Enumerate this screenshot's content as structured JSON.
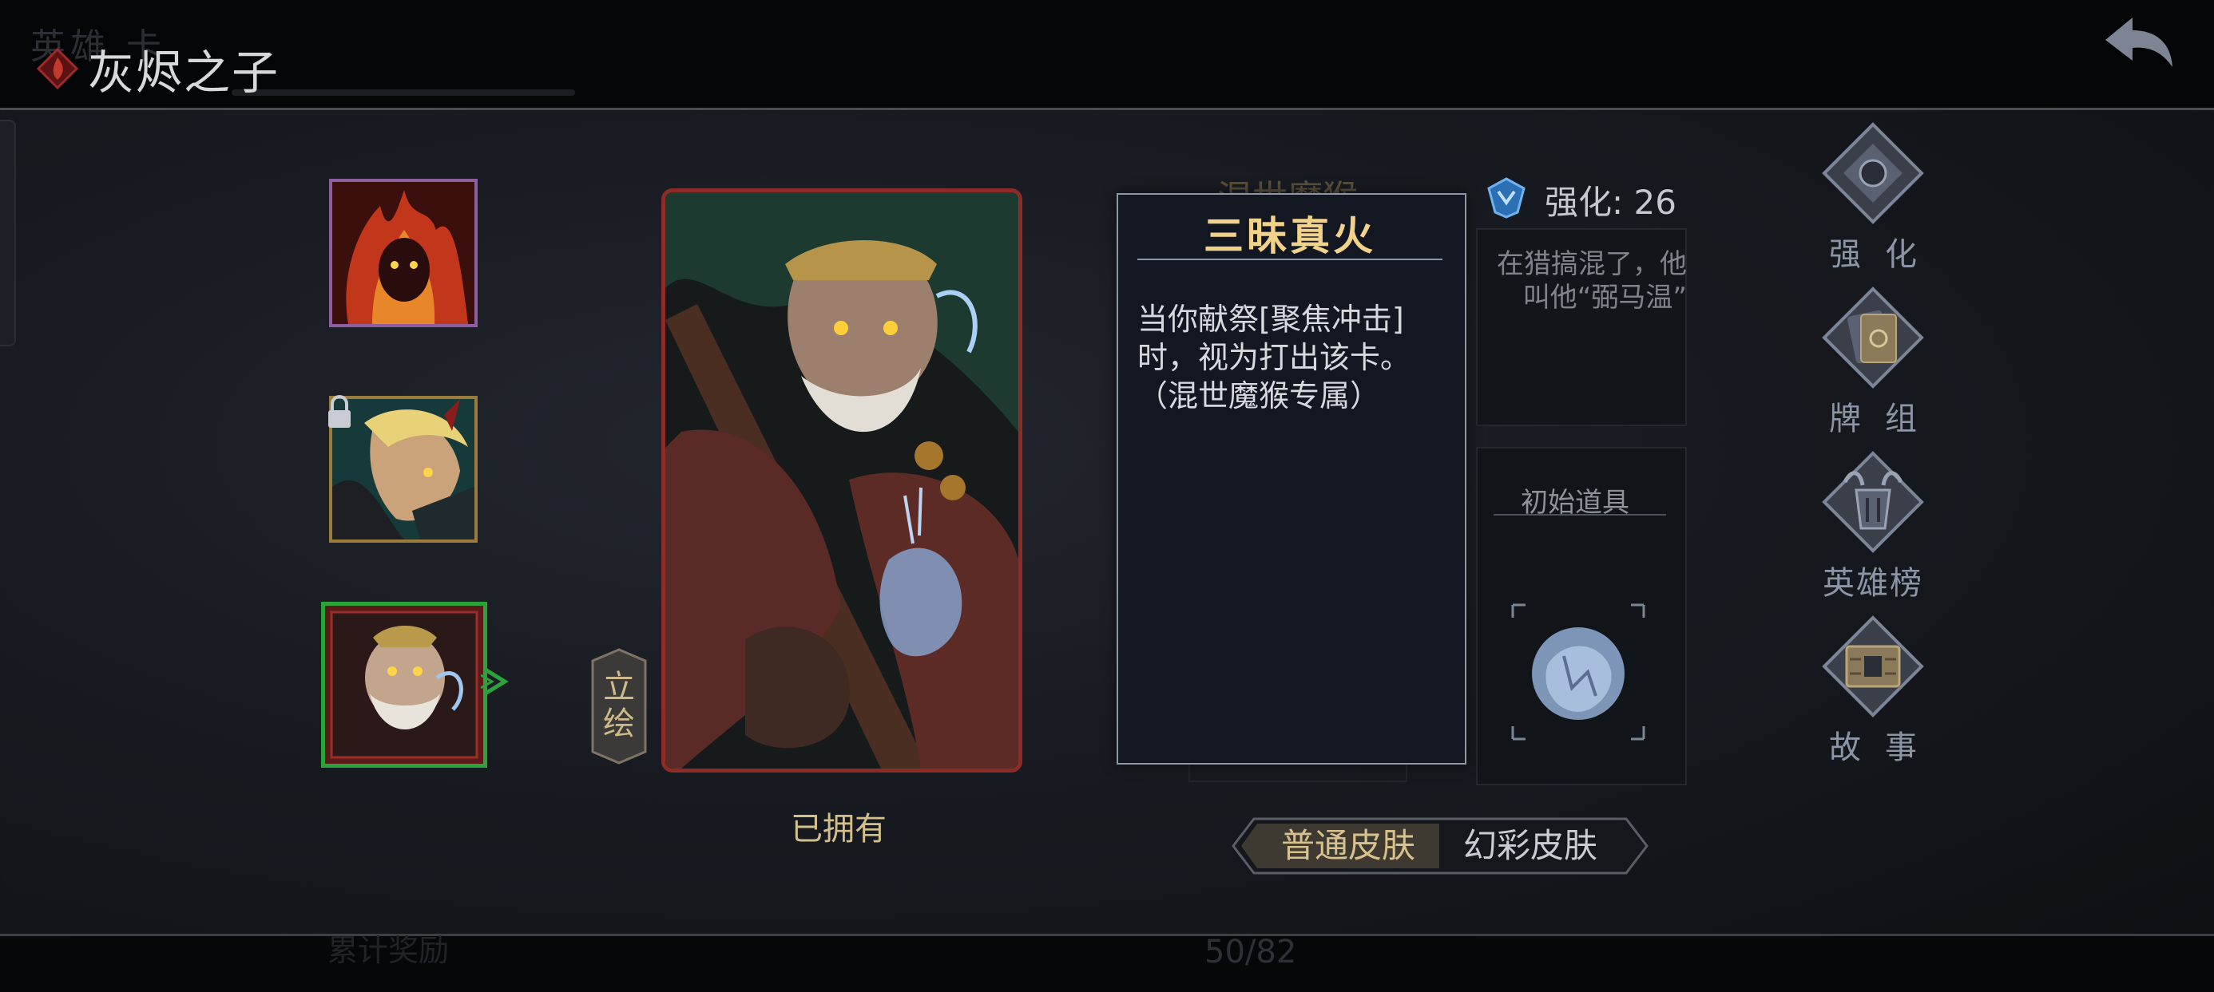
{
  "header": {
    "title": "灰烬之子",
    "ghost_tabs": "英雄  卡"
  },
  "heroes": {
    "art_toggle_label": "立绘",
    "owned_label": "已拥有"
  },
  "hero_panel": {
    "ghost_name": "混世魔猴",
    "enhance_label": "强化: 26",
    "story_fragment": "在猎搞混了，他\n叫他“弼马温”",
    "initial_item_label": "初始道具"
  },
  "tooltip": {
    "title": "三昧真火",
    "body": "当你献祭[聚焦冲击]时，视为打出该卡。（混世魔猴专属）"
  },
  "skins": {
    "normal": "普通皮肤",
    "fancy": "幻彩皮肤"
  },
  "side_menu": [
    {
      "label": "强化",
      "icon": "enhance-icon"
    },
    {
      "label": "牌组",
      "icon": "deck-icon"
    },
    {
      "label": "英雄榜",
      "icon": "leaderboard-icon"
    },
    {
      "label": "故事",
      "icon": "story-icon"
    }
  ],
  "footer": {
    "page_count": "50/82",
    "ghost_text": "累计奖励"
  },
  "colors": {
    "accent_gold": "#d3bf8b",
    "selected_green": "#2ba33a",
    "frame_red": "#8d2c26",
    "menu_steel": "#8c95a5"
  }
}
